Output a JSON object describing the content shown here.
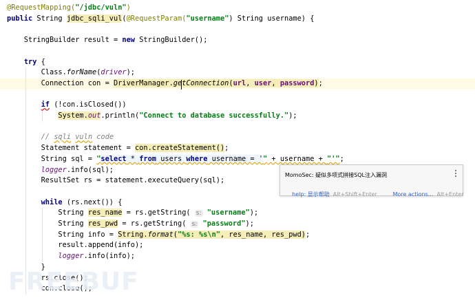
{
  "editor": {
    "lines": [
      {
        "tokens": [
          {
            "t": "@RequestMapping(",
            "c": "ann"
          },
          {
            "t": "\"/jdbc/vuln\"",
            "c": "str"
          },
          {
            "t": ")",
            "c": "ann"
          }
        ]
      },
      {
        "tokens": [
          {
            "t": "public ",
            "c": "kw"
          },
          {
            "t": "String ",
            "c": "plain"
          },
          {
            "t": "jdbc_sqli_vul",
            "c": "plain hl"
          },
          {
            "t": "(",
            "c": "plain"
          },
          {
            "t": "@RequestParam(",
            "c": "ann"
          },
          {
            "t": "\"username\"",
            "c": "str"
          },
          {
            "t": ") String username) {",
            "c": "plain"
          }
        ]
      },
      {
        "tokens": []
      },
      {
        "tokens": [
          {
            "t": "    StringBuilder result = ",
            "c": "plain"
          },
          {
            "t": "new ",
            "c": "kw"
          },
          {
            "t": "StringBuilder();",
            "c": "plain"
          }
        ]
      },
      {
        "tokens": []
      },
      {
        "tokens": [
          {
            "t": "    ",
            "c": "plain"
          },
          {
            "t": "try ",
            "c": "kw"
          },
          {
            "t": "{",
            "c": "plain"
          }
        ]
      },
      {
        "tokens": [
          {
            "t": "        Class.",
            "c": "plain"
          },
          {
            "t": "forName",
            "c": "italic"
          },
          {
            "t": "(",
            "c": "plain"
          },
          {
            "t": "driver",
            "c": "field"
          },
          {
            "t": ");",
            "c": "plain"
          }
        ]
      },
      {
        "tokens": [
          {
            "t": "        Connection con = ",
            "c": "plain"
          },
          {
            "t": "DriverManager.",
            "c": "plain hl"
          },
          {
            "t": "getConnection",
            "c": "italic hl"
          },
          {
            "t": "(",
            "c": "plain hl"
          },
          {
            "t": "url",
            "c": "purple hl"
          },
          {
            "t": ", ",
            "c": "plain hl"
          },
          {
            "t": "user",
            "c": "purple hl"
          },
          {
            "t": ", ",
            "c": "plain hl"
          },
          {
            "t": "password",
            "c": "purple hl"
          },
          {
            "t": ")",
            "c": "plain hl"
          },
          {
            "t": ";",
            "c": "plain"
          }
        ],
        "current": true
      },
      {
        "tokens": []
      },
      {
        "tokens": [
          {
            "t": "        ",
            "c": "plain"
          },
          {
            "t": "if",
            "c": "kw err"
          },
          {
            "t": " (!con.isClosed())",
            "c": "plain"
          }
        ]
      },
      {
        "tokens": [
          {
            "t": "            ",
            "c": "plain"
          },
          {
            "t": "System.",
            "c": "plain hl"
          },
          {
            "t": "out",
            "c": "field hl"
          },
          {
            "t": ".println(",
            "c": "plain"
          },
          {
            "t": "\"Connect to database successfully.\"",
            "c": "str"
          },
          {
            "t": ");",
            "c": "plain"
          }
        ]
      },
      {
        "tokens": []
      },
      {
        "tokens": [
          {
            "t": "        // ",
            "c": "comment"
          },
          {
            "t": "sqli",
            "c": "comment warn"
          },
          {
            "t": " ",
            "c": "comment"
          },
          {
            "t": "vuln",
            "c": "comment warn"
          },
          {
            "t": " code",
            "c": "comment"
          }
        ]
      },
      {
        "tokens": [
          {
            "t": "        Statement statement = ",
            "c": "plain"
          },
          {
            "t": "con.createStatement()",
            "c": "plain hl"
          },
          {
            "t": ";",
            "c": "plain"
          }
        ]
      },
      {
        "tokens": [
          {
            "t": "        String sql = ",
            "c": "plain"
          },
          {
            "t": "\"",
            "c": "str warn"
          },
          {
            "t": "select",
            "c": "kw sql warn"
          },
          {
            "t": " * ",
            "c": "plain sql warn"
          },
          {
            "t": "from",
            "c": "kw sql warn"
          },
          {
            "t": " users ",
            "c": "plain sql warn"
          },
          {
            "t": "where",
            "c": "kw sql warn"
          },
          {
            "t": " username = '",
            "c": "plain sql warn"
          },
          {
            "t": "\"",
            "c": "str warn"
          },
          {
            "t": " + username + ",
            "c": "plain warn"
          },
          {
            "t": "\"'\"",
            "c": "str warn"
          },
          {
            "t": ";",
            "c": "plain"
          }
        ]
      },
      {
        "tokens": [
          {
            "t": "        ",
            "c": "plain"
          },
          {
            "t": "logger",
            "c": "field"
          },
          {
            "t": ".info(sql);",
            "c": "plain"
          }
        ]
      },
      {
        "tokens": [
          {
            "t": "        ResultSet rs = statement.executeQuery(sql);",
            "c": "plain"
          }
        ]
      },
      {
        "tokens": []
      },
      {
        "tokens": [
          {
            "t": "        ",
            "c": "plain"
          },
          {
            "t": "while ",
            "c": "kw"
          },
          {
            "t": "(rs.next()) {",
            "c": "plain"
          }
        ]
      },
      {
        "tokens": [
          {
            "t": "            String ",
            "c": "plain"
          },
          {
            "t": "res_name",
            "c": "plain hl"
          },
          {
            "t": " = rs.getString( ",
            "c": "plain"
          },
          {
            "t": "s:",
            "c": "hint"
          },
          {
            "t": " ",
            "c": "plain"
          },
          {
            "t": "\"username\"",
            "c": "str"
          },
          {
            "t": ");",
            "c": "plain"
          }
        ]
      },
      {
        "tokens": [
          {
            "t": "            String ",
            "c": "plain"
          },
          {
            "t": "res_pwd",
            "c": "plain hl"
          },
          {
            "t": " = rs.getString( ",
            "c": "plain"
          },
          {
            "t": "s:",
            "c": "hint"
          },
          {
            "t": " ",
            "c": "plain"
          },
          {
            "t": "\"password\"",
            "c": "str"
          },
          {
            "t": ");",
            "c": "plain"
          }
        ]
      },
      {
        "tokens": [
          {
            "t": "            String info = ",
            "c": "plain"
          },
          {
            "t": "String.",
            "c": "plain hl"
          },
          {
            "t": "format",
            "c": "italic hl"
          },
          {
            "t": "(",
            "c": "plain hl"
          },
          {
            "t": "\"%s: %s\\n\"",
            "c": "str hl"
          },
          {
            "t": ", res_name, res_pwd)",
            "c": "plain hl"
          },
          {
            "t": ";",
            "c": "plain"
          }
        ]
      },
      {
        "tokens": [
          {
            "t": "            result.append(info);",
            "c": "plain"
          }
        ]
      },
      {
        "tokens": [
          {
            "t": "            ",
            "c": "plain"
          },
          {
            "t": "logger",
            "c": "field"
          },
          {
            "t": ".info(info);",
            "c": "plain"
          }
        ]
      },
      {
        "tokens": [
          {
            "t": "        }",
            "c": "plain"
          }
        ]
      },
      {
        "tokens": [
          {
            "t": "        rs.close();",
            "c": "plain"
          }
        ]
      },
      {
        "tokens": [
          {
            "t": "        con.close();",
            "c": "plain"
          }
        ]
      }
    ]
  },
  "popup": {
    "message": "MomoSec: 疑似多项式拼接SQL注入漏洞",
    "help_link": "help: 显示帮助",
    "help_shortcut": "Alt+Shift+Enter",
    "more_link": "More actions...",
    "more_shortcut": "Alt+Enter",
    "menu_icon": "kebab-menu-icon"
  },
  "watermark": "FREEBUF"
}
